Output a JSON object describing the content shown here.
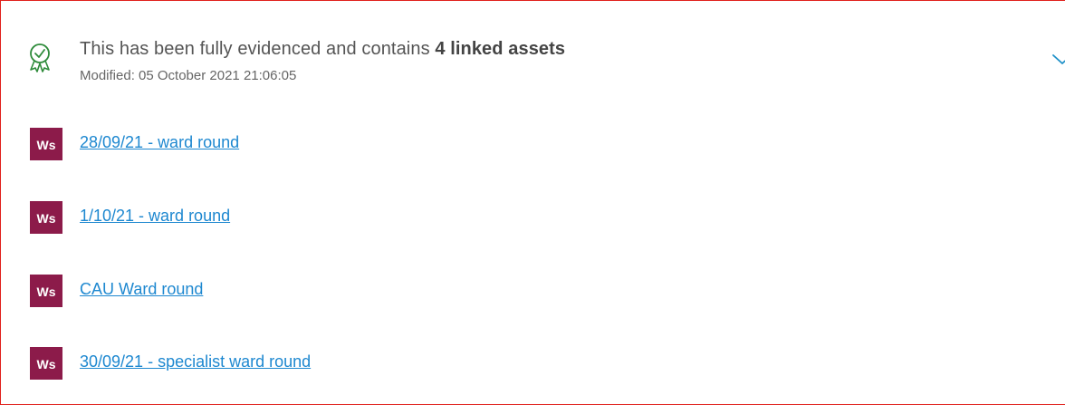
{
  "summary": {
    "text_prefix": "This has been fully evidenced and contains ",
    "text_bold": "4 linked assets",
    "modified": "Modified: 05 October 2021 21:06:05",
    "icon": "award-ribbon-check-icon"
  },
  "colors": {
    "border": "#e0201c",
    "asset_badge": "#8c1b4a",
    "link": "#1e88d0",
    "icon_green": "#2e8b3a",
    "chevron": "#1e90c8"
  },
  "assets": [
    {
      "type": "Ws",
      "title": "28/09/21 - ward round"
    },
    {
      "type": "Ws",
      "title": "1/10/21 - ward round"
    },
    {
      "type": "Ws",
      "title": "CAU Ward round"
    },
    {
      "type": "Ws",
      "title": "30/09/21 - specialist ward round"
    }
  ]
}
